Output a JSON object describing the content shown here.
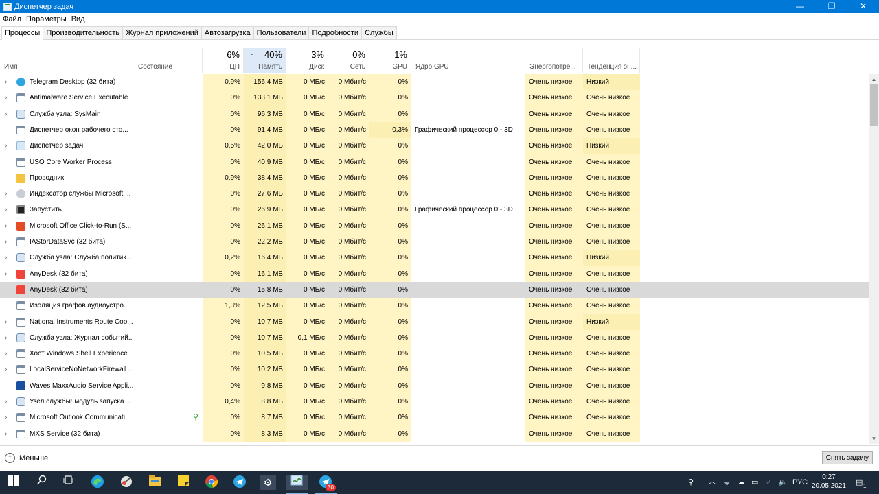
{
  "window": {
    "title": "Диспетчер задач",
    "controls": [
      "—",
      "❐",
      "✕"
    ]
  },
  "menu": [
    "Файл",
    "Параметры",
    "Вид"
  ],
  "tabs": [
    "Процессы",
    "Производительность",
    "Журнал приложений",
    "Автозагрузка",
    "Пользователи",
    "Подробности",
    "Службы"
  ],
  "active_tab": "Процессы",
  "columns": {
    "name": "Имя",
    "status": "Состояние",
    "cpu": {
      "label": "ЦП",
      "pct": "6%"
    },
    "memory": {
      "label": "Память",
      "pct": "40%"
    },
    "disk": {
      "label": "Диск",
      "pct": "3%"
    },
    "network": {
      "label": "Сеть",
      "pct": "0%"
    },
    "gpu": {
      "label": "GPU",
      "pct": "1%"
    },
    "gpu_engine": "Ядро GPU",
    "power": "Энергопотре...",
    "power_trend": "Тенденция эн..."
  },
  "processes": [
    {
      "name": "Telegram Desktop (32 бита)",
      "icon": "telegram-icon",
      "expand": true,
      "cpu": "0,9%",
      "mem": "156,4 МБ",
      "disk": "0 МБ/с",
      "net": "0 Мбит/с",
      "gpu": "0%",
      "engine": "",
      "power": "Очень низкое",
      "trend": "Низкий"
    },
    {
      "name": "Antimalware Service Executable",
      "icon": "app-window-icon",
      "expand": true,
      "cpu": "0%",
      "mem": "133,1 МБ",
      "disk": "0 МБ/с",
      "net": "0 Мбит/с",
      "gpu": "0%",
      "engine": "",
      "power": "Очень низкое",
      "trend": "Очень низкое"
    },
    {
      "name": "Служба узла: SysMain",
      "icon": "gear-service-icon",
      "expand": true,
      "cpu": "0%",
      "mem": "96,3 МБ",
      "disk": "0 МБ/с",
      "net": "0 Мбит/с",
      "gpu": "0%",
      "engine": "",
      "power": "Очень низкое",
      "trend": "Очень низкое"
    },
    {
      "name": "Диспетчер окон рабочего сто...",
      "icon": "app-window-icon",
      "expand": false,
      "cpu": "0%",
      "mem": "91,4 МБ",
      "disk": "0 МБ/с",
      "net": "0 Мбит/с",
      "gpu": "0,3%",
      "engine": "Графический процессор 0 - 3D",
      "power": "Очень низкое",
      "trend": "Очень низкое"
    },
    {
      "name": "Диспетчер задач",
      "icon": "task-manager-icon",
      "expand": true,
      "cpu": "0,5%",
      "mem": "42,0 МБ",
      "disk": "0 МБ/с",
      "net": "0 Мбит/с",
      "gpu": "0%",
      "engine": "",
      "power": "Очень низкое",
      "trend": "Низкий"
    },
    {
      "name": "USO Core Worker Process",
      "icon": "app-window-icon",
      "expand": false,
      "cpu": "0%",
      "mem": "40,9 МБ",
      "disk": "0 МБ/с",
      "net": "0 Мбит/с",
      "gpu": "0%",
      "engine": "",
      "power": "Очень низкое",
      "trend": "Очень низкое"
    },
    {
      "name": "Проводник",
      "icon": "folder-icon",
      "expand": false,
      "cpu": "0,9%",
      "mem": "38,4 МБ",
      "disk": "0 МБ/с",
      "net": "0 Мбит/с",
      "gpu": "0%",
      "engine": "",
      "power": "Очень низкое",
      "trend": "Очень низкое"
    },
    {
      "name": "Индексатор службы Microsoft ...",
      "icon": "indexer-icon",
      "expand": true,
      "cpu": "0%",
      "mem": "27,6 МБ",
      "disk": "0 МБ/с",
      "net": "0 Мбит/с",
      "gpu": "0%",
      "engine": "",
      "power": "Очень низкое",
      "trend": "Очень низкое"
    },
    {
      "name": "Запустить",
      "icon": "start-app-icon",
      "expand": true,
      "cpu": "0%",
      "mem": "26,9 МБ",
      "disk": "0 МБ/с",
      "net": "0 Мбит/с",
      "gpu": "0%",
      "engine": "Графический процессор 0 - 3D",
      "power": "Очень низкое",
      "trend": "Очень низкое"
    },
    {
      "name": "Microsoft Office Click-to-Run (S...",
      "icon": "office-icon",
      "expand": true,
      "cpu": "0%",
      "mem": "26,1 МБ",
      "disk": "0 МБ/с",
      "net": "0 Мбит/с",
      "gpu": "0%",
      "engine": "",
      "power": "Очень низкое",
      "trend": "Очень низкое"
    },
    {
      "name": "IAStorDataSvc (32 бита)",
      "icon": "app-window-icon",
      "expand": true,
      "cpu": "0%",
      "mem": "22,2 МБ",
      "disk": "0 МБ/с",
      "net": "0 Мбит/с",
      "gpu": "0%",
      "engine": "",
      "power": "Очень низкое",
      "trend": "Очень низкое"
    },
    {
      "name": "Служба узла: Служба политик...",
      "icon": "gear-service-icon",
      "expand": true,
      "cpu": "0,2%",
      "mem": "16,4 МБ",
      "disk": "0 МБ/с",
      "net": "0 Мбит/с",
      "gpu": "0%",
      "engine": "",
      "power": "Очень низкое",
      "trend": "Низкий"
    },
    {
      "name": "AnyDesk (32 бита)",
      "icon": "anydesk-icon",
      "expand": true,
      "cpu": "0%",
      "mem": "16,1 МБ",
      "disk": "0 МБ/с",
      "net": "0 Мбит/с",
      "gpu": "0%",
      "engine": "",
      "power": "Очень низкое",
      "trend": "Очень низкое"
    },
    {
      "name": "AnyDesk (32 бита)",
      "icon": "anydesk-icon",
      "expand": false,
      "selected": true,
      "cpu": "0%",
      "mem": "15,8 МБ",
      "disk": "0 МБ/с",
      "net": "0 Мбит/с",
      "gpu": "0%",
      "engine": "",
      "power": "Очень низкое",
      "trend": "Очень низкое"
    },
    {
      "name": "Изоляция графов аудиоустро...",
      "icon": "app-window-icon",
      "expand": false,
      "cpu": "1,3%",
      "mem": "12,5 МБ",
      "disk": "0 МБ/с",
      "net": "0 Мбит/с",
      "gpu": "0%",
      "engine": "",
      "power": "Очень низкое",
      "trend": "Очень низкое"
    },
    {
      "name": "National Instruments Route Coo...",
      "icon": "app-window-icon",
      "expand": true,
      "cpu": "0%",
      "mem": "10,7 МБ",
      "disk": "0 МБ/с",
      "net": "0 Мбит/с",
      "gpu": "0%",
      "engine": "",
      "power": "Очень низкое",
      "trend": "Низкий"
    },
    {
      "name": "Служба узла: Журнал событий...",
      "icon": "gear-service-icon",
      "expand": true,
      "cpu": "0%",
      "mem": "10,7 МБ",
      "disk": "0,1 МБ/с",
      "net": "0 Мбит/с",
      "gpu": "0%",
      "engine": "",
      "power": "Очень низкое",
      "trend": "Очень низкое"
    },
    {
      "name": "Хост Windows Shell Experience",
      "icon": "app-window-icon",
      "expand": true,
      "cpu": "0%",
      "mem": "10,5 МБ",
      "disk": "0 МБ/с",
      "net": "0 Мбит/с",
      "gpu": "0%",
      "engine": "",
      "power": "Очень низкое",
      "trend": "Очень низкое"
    },
    {
      "name": "LocalServiceNoNetworkFirewall ...",
      "icon": "app-window-icon",
      "expand": true,
      "cpu": "0%",
      "mem": "10,2 МБ",
      "disk": "0 МБ/с",
      "net": "0 Мбит/с",
      "gpu": "0%",
      "engine": "",
      "power": "Очень низкое",
      "trend": "Очень низкое"
    },
    {
      "name": "Waves MaxxAudio Service Appli...",
      "icon": "waves-icon",
      "expand": false,
      "cpu": "0%",
      "mem": "9,8 МБ",
      "disk": "0 МБ/с",
      "net": "0 Мбит/с",
      "gpu": "0%",
      "engine": "",
      "power": "Очень низкое",
      "trend": "Очень низкое"
    },
    {
      "name": "Узел службы: модуль запуска ...",
      "icon": "gear-service-icon",
      "expand": true,
      "cpu": "0,4%",
      "mem": "8,8 МБ",
      "disk": "0 МБ/с",
      "net": "0 Мбит/с",
      "gpu": "0%",
      "engine": "",
      "power": "Очень низкое",
      "trend": "Очень низкое"
    },
    {
      "name": "Microsoft Outlook Communicati...",
      "icon": "app-window-icon",
      "expand": true,
      "leaf": true,
      "cpu": "0%",
      "mem": "8,7 МБ",
      "disk": "0 МБ/с",
      "net": "0 Мбит/с",
      "gpu": "0%",
      "engine": "",
      "power": "Очень низкое",
      "trend": "Очень низкое"
    },
    {
      "name": "MXS Service (32 бита)",
      "icon": "app-window-icon",
      "expand": true,
      "cpu": "0%",
      "mem": "8,3 МБ",
      "disk": "0 МБ/с",
      "net": "0 Мбит/с",
      "gpu": "0%",
      "engine": "",
      "power": "Очень низкое",
      "trend": "Очень низкое"
    }
  ],
  "footer": {
    "less_label": "Меньше",
    "end_task_label": "Снять задачу"
  },
  "taskbar": {
    "apps": [
      "windows-start-icon",
      "search-icon",
      "task-view-icon",
      "edge-icon",
      "snipping-icon",
      "file-explorer-icon",
      "sticky-notes-icon",
      "chrome-icon",
      "telegram-icon",
      "settings-icon",
      "task-manager-icon",
      "telegram-badge-icon"
    ],
    "telegram_badge": "30",
    "lang": "РУС",
    "time": "0:27",
    "date": "20.05.2021",
    "notification_count": "1"
  },
  "colors": {
    "titlebar": "#0078d7",
    "heat": "#fff4c4",
    "selected": "#d9d9d9",
    "taskbar": "#1c2a3a"
  }
}
